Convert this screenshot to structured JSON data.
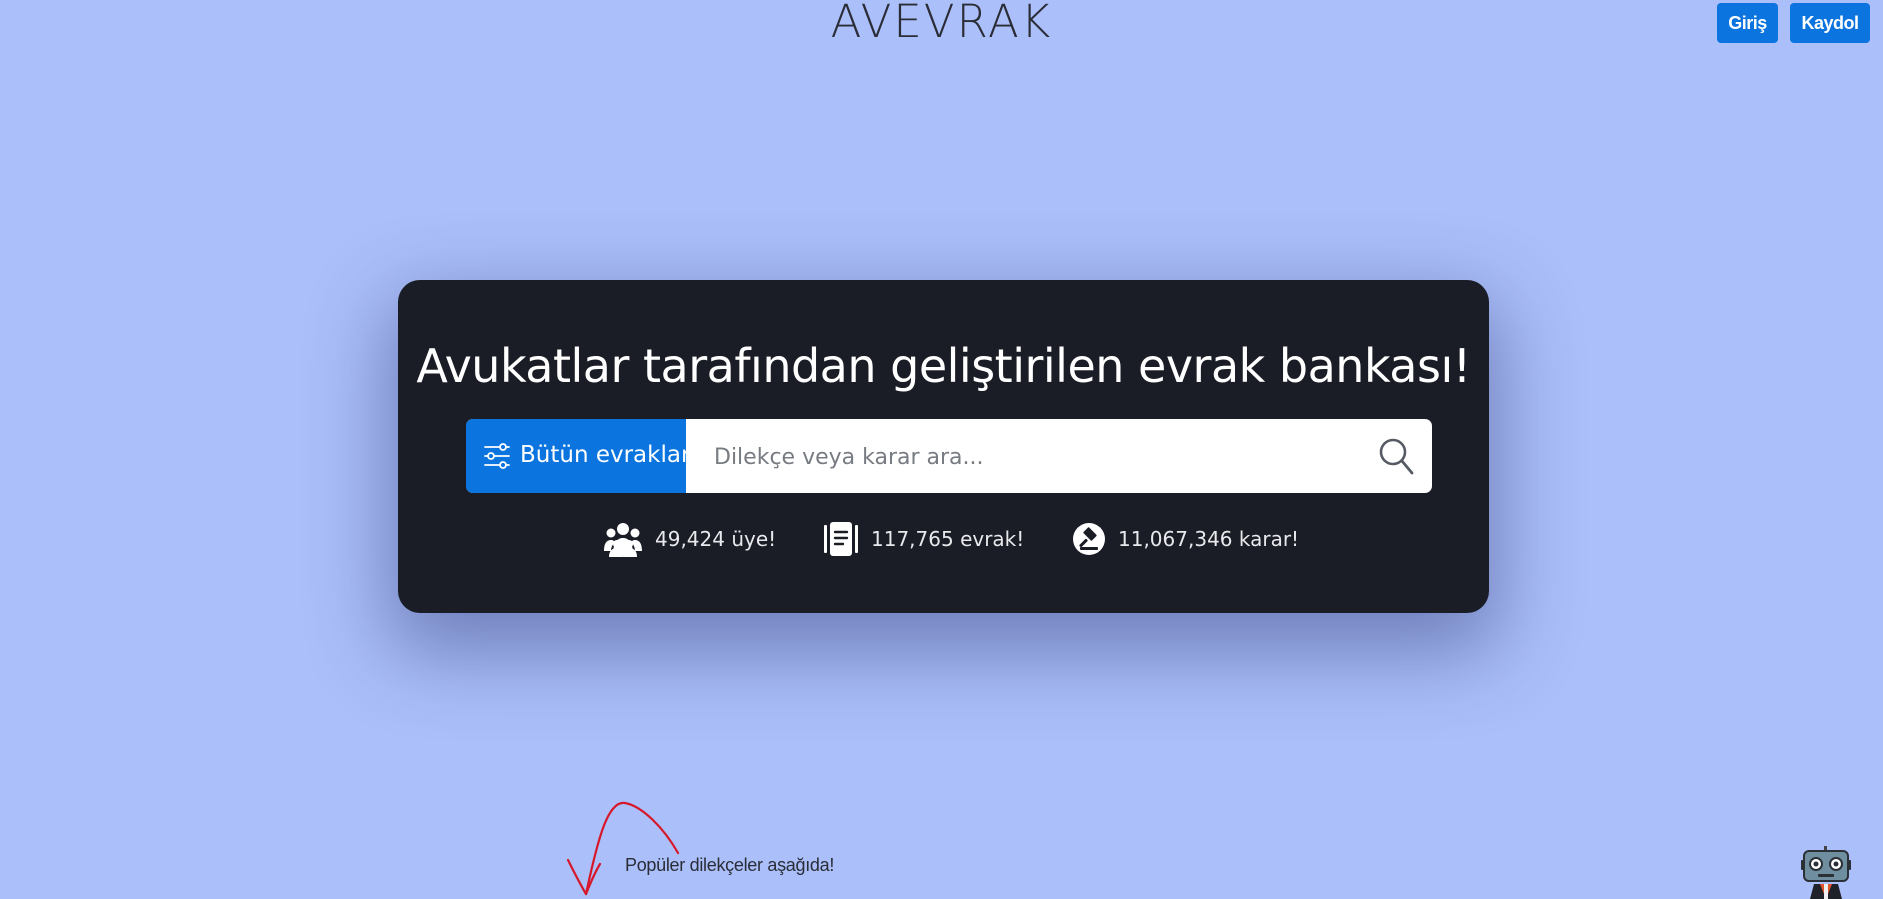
{
  "header": {
    "logo": "AVEVRAK",
    "login_label": "Giriş",
    "signup_label": "Kaydol"
  },
  "hero": {
    "headline": "Avukatlar tarafından geliştirilen evrak bankası!",
    "filter_label": "Bütün evraklar",
    "search_placeholder": "Dilekçe veya karar ara...",
    "stats": {
      "members": "49,424 üye!",
      "documents": "117,765 evrak!",
      "decisions": "11,067,346 karar!"
    }
  },
  "footer_hint": {
    "text": "Popüler dilekçeler aşağıda!"
  },
  "icons": {
    "filter": "sliders-icon",
    "search": "search-icon",
    "members": "users-icon",
    "documents": "document-icon",
    "decisions": "gavel-icon",
    "arrow": "curved-arrow-down-icon",
    "mascot": "robot-mascot-icon"
  },
  "colors": {
    "background": "#abbffa",
    "card": "#1b1d26",
    "accent": "#0b74de",
    "arrow": "#d6182a"
  }
}
